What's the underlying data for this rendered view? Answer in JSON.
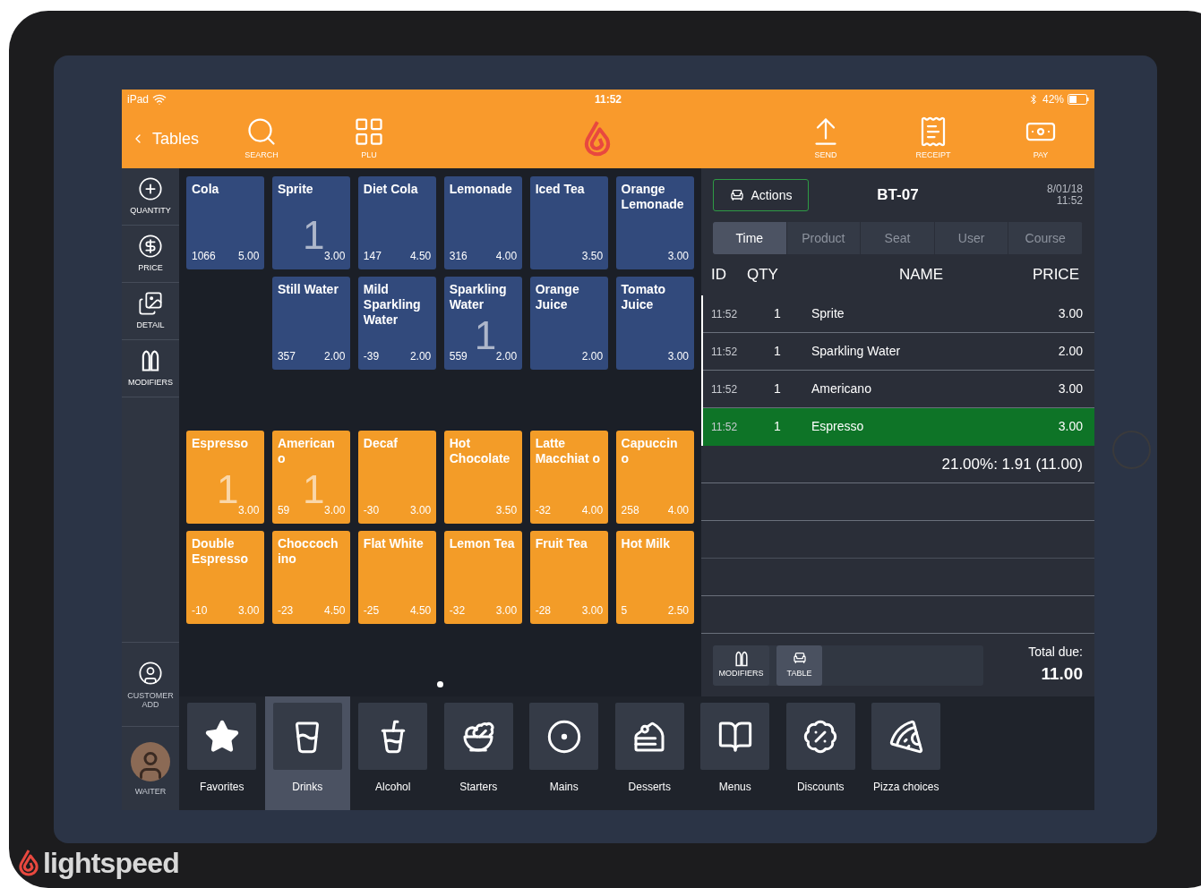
{
  "status_bar": {
    "device": "iPad",
    "time": "11:52",
    "battery": "42%"
  },
  "toolbar": {
    "back": "Tables",
    "left_buttons": [
      {
        "kind": "search",
        "label": "SEARCH"
      },
      {
        "kind": "plu",
        "label": "PLU"
      }
    ],
    "right_buttons": [
      {
        "kind": "send",
        "label": "SEND"
      },
      {
        "kind": "receipt",
        "label": "RECEIPT"
      },
      {
        "kind": "pay",
        "label": "PAY"
      }
    ]
  },
  "sidebar": {
    "top_items": [
      {
        "kind": "quantity",
        "label": "QUANTITY"
      },
      {
        "kind": "price",
        "label": "PRICE"
      },
      {
        "kind": "detail",
        "label": "DETAIL"
      },
      {
        "kind": "modifiers",
        "label": "MODIFIERS"
      }
    ],
    "bottom_items": [
      {
        "kind": "customer",
        "label": "CUSTOMER ADD"
      },
      {
        "kind": "waiter",
        "label": "WAITER"
      }
    ]
  },
  "product_groups": [
    {
      "tiles": [
        {
          "kind": "product",
          "color": "#324a7c",
          "name": "Cola",
          "stock": "1066",
          "price": "5.00"
        },
        {
          "kind": "product",
          "color": "#324a7c",
          "name": "Sprite",
          "price": "3.00",
          "ordered": "1"
        },
        {
          "kind": "product",
          "color": "#324a7c",
          "name": "Diet Cola",
          "stock": "147",
          "price": "4.50"
        },
        {
          "kind": "product",
          "color": "#324a7c",
          "name": "Lemonade",
          "stock": "316",
          "price": "4.00"
        },
        {
          "kind": "product",
          "color": "#324a7c",
          "name": "Iced Tea",
          "price": "3.50"
        },
        {
          "kind": "product",
          "color": "#324a7c",
          "name": "Orange Lemonade",
          "price": "3.00"
        },
        {
          "kind": "empty"
        },
        {
          "kind": "product",
          "color": "#324a7c",
          "name": "Still Water",
          "stock": "357",
          "price": "2.00"
        },
        {
          "kind": "product",
          "color": "#324a7c",
          "name": "Mild Sparkling Water",
          "stock": "-39",
          "price": "2.00"
        },
        {
          "kind": "product",
          "color": "#324a7c",
          "name": "Sparkling Water",
          "stock": "559",
          "price": "2.00",
          "ordered": "1"
        },
        {
          "kind": "product",
          "color": "#324a7c",
          "name": "Orange Juice",
          "price": "2.00"
        },
        {
          "kind": "product",
          "color": "#324a7c",
          "name": "Tomato Juice",
          "price": "3.00"
        }
      ]
    },
    {
      "tiles": [
        {
          "kind": "product",
          "color": "#f39c28",
          "name": "Espresso",
          "price": "3.00",
          "ordered": "1"
        },
        {
          "kind": "product",
          "color": "#f39c28",
          "name": "American o",
          "stock": "59",
          "price": "3.00",
          "ordered": "1"
        },
        {
          "kind": "product",
          "color": "#f39c28",
          "name": "Decaf",
          "stock": "-30",
          "price": "3.00"
        },
        {
          "kind": "product",
          "color": "#f39c28",
          "name": "Hot Chocolate",
          "price": "3.50"
        },
        {
          "kind": "product",
          "color": "#f39c28",
          "name": "Latte Macchiat o",
          "stock": "-32",
          "price": "4.00"
        },
        {
          "kind": "product",
          "color": "#f39c28",
          "name": "Capuccin o",
          "stock": "258",
          "price": "4.00"
        },
        {
          "kind": "product",
          "color": "#f39c28",
          "name": "Double Espresso",
          "stock": "-10",
          "price": "3.00"
        },
        {
          "kind": "product",
          "color": "#f39c28",
          "name": "Choccoch ino",
          "stock": "-23",
          "price": "4.50"
        },
        {
          "kind": "product",
          "color": "#f39c28",
          "name": "Flat White",
          "stock": "-25",
          "price": "4.50"
        },
        {
          "kind": "product",
          "color": "#f39c28",
          "name": "Lemon Tea",
          "stock": "-32",
          "price": "3.00"
        },
        {
          "kind": "product",
          "color": "#f39c28",
          "name": "Fruit Tea",
          "stock": "-28",
          "price": "3.00"
        },
        {
          "kind": "product",
          "color": "#f39c28",
          "name": "Hot Milk",
          "stock": "5",
          "price": "2.50"
        }
      ]
    }
  ],
  "order": {
    "actions": "Actions",
    "table": "BT-07",
    "date": "8/01/18",
    "time": "11:52",
    "sort_tabs": [
      {
        "label": "Time",
        "selected": true
      },
      {
        "label": "Product",
        "selected": false
      },
      {
        "label": "Seat",
        "selected": false
      },
      {
        "label": "User",
        "selected": false
      },
      {
        "label": "Course",
        "selected": false
      }
    ],
    "columns": [
      "ID",
      "QTY",
      "NAME",
      "PRICE"
    ],
    "rows": [
      {
        "id": "11:52",
        "qty": "1",
        "name": "Sprite",
        "price": "3.00",
        "selected": false
      },
      {
        "id": "11:52",
        "qty": "1",
        "name": "Sparkling Water",
        "price": "2.00",
        "selected": false
      },
      {
        "id": "11:52",
        "qty": "1",
        "name": "Americano",
        "price": "3.00",
        "selected": false
      },
      {
        "id": "11:52",
        "qty": "1",
        "name": "Espresso",
        "price": "3.00",
        "selected": true
      }
    ],
    "tax": "21.00%: 1.91 (11.00)",
    "footer_buttons": [
      {
        "kind": "modifiers",
        "label": "MODIFIERS",
        "selected": false
      },
      {
        "kind": "table",
        "label": "TABLE",
        "selected": true
      }
    ],
    "total_label": "Total due:",
    "total": "11.00"
  },
  "categories": [
    {
      "kind": "star",
      "label": "Favorites",
      "selected": false
    },
    {
      "kind": "drinks",
      "label": "Drinks",
      "selected": true
    },
    {
      "kind": "alcohol",
      "label": "Alcohol",
      "selected": false
    },
    {
      "kind": "starters",
      "label": "Starters",
      "selected": false
    },
    {
      "kind": "mains",
      "label": "Mains",
      "selected": false
    },
    {
      "kind": "desserts",
      "label": "Desserts",
      "selected": false
    },
    {
      "kind": "menus",
      "label": "Menus",
      "selected": false
    },
    {
      "kind": "discounts",
      "label": "Discounts",
      "selected": false
    },
    {
      "kind": "pizza",
      "label": "Pizza choices",
      "selected": false
    }
  ],
  "brand": "lightspeed"
}
